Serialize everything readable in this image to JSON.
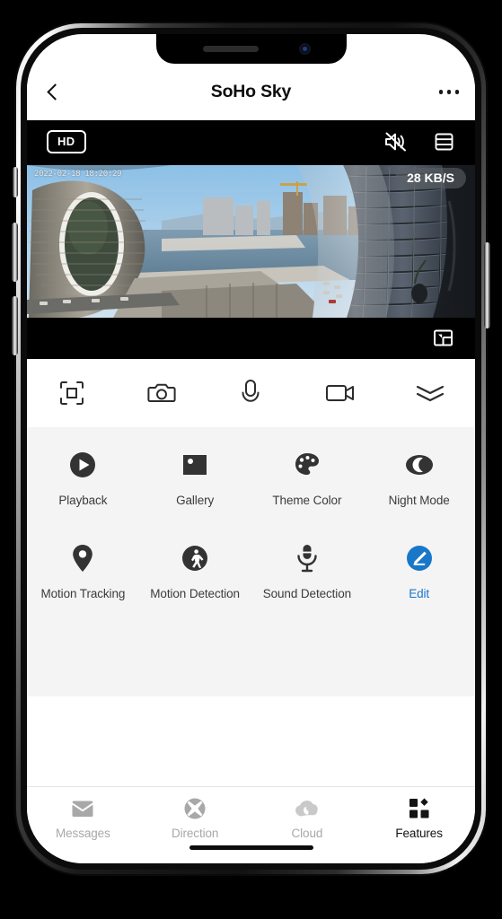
{
  "header": {
    "back_icon": "chevron-left-icon",
    "title": "SoHo Sky",
    "more_icon": "more-options-icon"
  },
  "player": {
    "quality_badge": "HD",
    "mute_icon": "speaker-muted-icon",
    "layout_icon": "split-layout-icon",
    "pip_icon": "picture-in-picture-icon",
    "timestamp": "2022-02-18 18:20:29",
    "bitrate": "28 KB/S"
  },
  "quick_actions": [
    {
      "name": "fullscreen-button",
      "icon": "fullscreen-icon"
    },
    {
      "name": "snapshot-button",
      "icon": "camera-icon"
    },
    {
      "name": "talk-button",
      "icon": "microphone-icon"
    },
    {
      "name": "record-button",
      "icon": "video-camera-icon"
    },
    {
      "name": "expand-more-button",
      "icon": "double-chevron-down-icon"
    }
  ],
  "features": {
    "row1": [
      {
        "label": "Playback",
        "icon": "play-circle-icon"
      },
      {
        "label": "Gallery",
        "icon": "image-icon"
      },
      {
        "label": "Theme\nColor",
        "icon": "palette-icon"
      },
      {
        "label": "Night\nMode",
        "icon": "moon-eye-icon"
      }
    ],
    "row2": [
      {
        "label": "Motion\nTracking",
        "icon": "map-pin-icon"
      },
      {
        "label": "Motion\nDetection",
        "icon": "walking-person-icon"
      },
      {
        "label": "Sound\nDetection",
        "icon": "microphone-detect-icon"
      },
      {
        "label": "Edit",
        "icon": "pencil-circle-icon",
        "accent": true
      }
    ]
  },
  "tabs": [
    {
      "label": "Messages",
      "icon": "envelope-icon",
      "active": false
    },
    {
      "label": "Direction",
      "icon": "direction-pad-icon",
      "active": false
    },
    {
      "label": "Cloud",
      "icon": "cloud-icon",
      "active": false
    },
    {
      "label": "Features",
      "icon": "grid-features-icon",
      "active": true
    }
  ],
  "colors": {
    "accent": "#1877c9",
    "icon_dark": "#333333",
    "tab_inactive": "#a8a8a8",
    "panel_bg": "#f4f4f4"
  }
}
